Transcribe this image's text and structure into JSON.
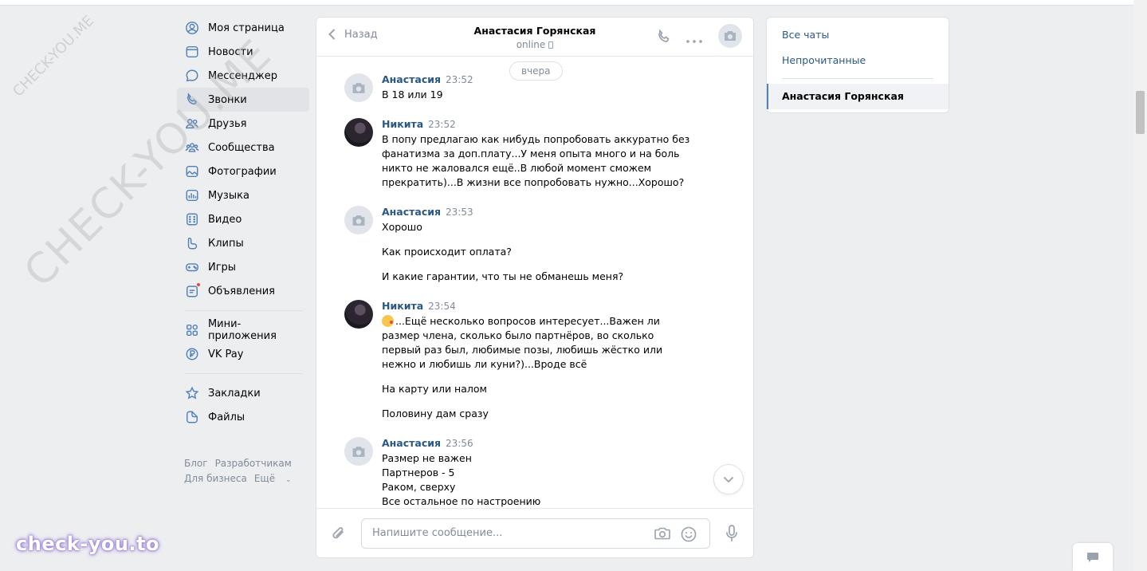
{
  "nav": {
    "items": [
      {
        "label": "Моя страница",
        "icon": "user-circle-icon"
      },
      {
        "label": "Новости",
        "icon": "news-icon"
      },
      {
        "label": "Мессенджер",
        "icon": "message-icon"
      },
      {
        "label": "Звонки",
        "icon": "phone-icon",
        "active": true
      },
      {
        "label": "Друзья",
        "icon": "friends-icon"
      },
      {
        "label": "Сообщества",
        "icon": "communities-icon"
      },
      {
        "label": "Фотографии",
        "icon": "photo-icon"
      },
      {
        "label": "Музыка",
        "icon": "music-icon"
      },
      {
        "label": "Видео",
        "icon": "video-icon"
      },
      {
        "label": "Клипы",
        "icon": "clips-icon"
      },
      {
        "label": "Игры",
        "icon": "games-icon"
      },
      {
        "label": "Объявления",
        "icon": "classifieds-icon"
      }
    ],
    "items2": [
      {
        "label": "Мини-приложения",
        "icon": "mini-apps-icon"
      },
      {
        "label": "VK Pay",
        "icon": "vkpay-icon"
      }
    ],
    "items3": [
      {
        "label": "Закладки",
        "icon": "bookmark-star-icon"
      },
      {
        "label": "Файлы",
        "icon": "files-icon"
      }
    ]
  },
  "footer": {
    "blog": "Блог",
    "developers": "Разработчикам",
    "business": "Для бизнеса",
    "more": "Ещё"
  },
  "chat": {
    "back_label": "Назад",
    "title": "Анастасия Горянская",
    "status": "online",
    "day_separator": "вчера",
    "messages": [
      {
        "author": "Анастасия",
        "time": "23:52",
        "lines": [
          "В 18 или 19"
        ]
      },
      {
        "author": "Никита",
        "time": "23:52",
        "lines": [
          "В попу предлагаю как нибудь попробовать аккуратно без фанатизма за доп.плату...У меня опыта много и на боль никто не жаловался ещё..В любой момент сможем прекратить)...В жизни все попробовать нужно...Хорошо?"
        ]
      },
      {
        "author": "Анастасия",
        "time": "23:53",
        "lines": [
          "Хорошо",
          "Как происходит оплата?",
          "И какие гарантии, что ты не обманешь меня?"
        ]
      },
      {
        "author": "Никита",
        "time": "23:54",
        "lines": [
          "...Ещё несколько вопросов интересует...Важен ли размер члена, сколько было партнёров, во сколько первый раз был, любимые позы, любишь жёстко или нежно и любишь ли куни?)...Вроде всё",
          "На карту или налом",
          "Половину дам сразу"
        ]
      },
      {
        "author": "Анастасия",
        "time": "23:56",
        "lines": [
          "Размер не важен",
          "Партнеров - 5",
          "Раком, сверху",
          "Все остальное по настроению"
        ]
      }
    ],
    "input_placeholder": "Напишите сообщение..."
  },
  "right_panel": {
    "all_chats": "Все чаты",
    "unread": "Непрочитанные",
    "active_chat": "Анастасия Горянская"
  },
  "watermarks": {
    "big": "CHECK-YOU.ME",
    "small": "CHECK-YOU.ME",
    "brand": "check-you.to"
  },
  "colors": {
    "accent": "#5181b8",
    "link": "#2a5885",
    "background": "#edeef0"
  }
}
